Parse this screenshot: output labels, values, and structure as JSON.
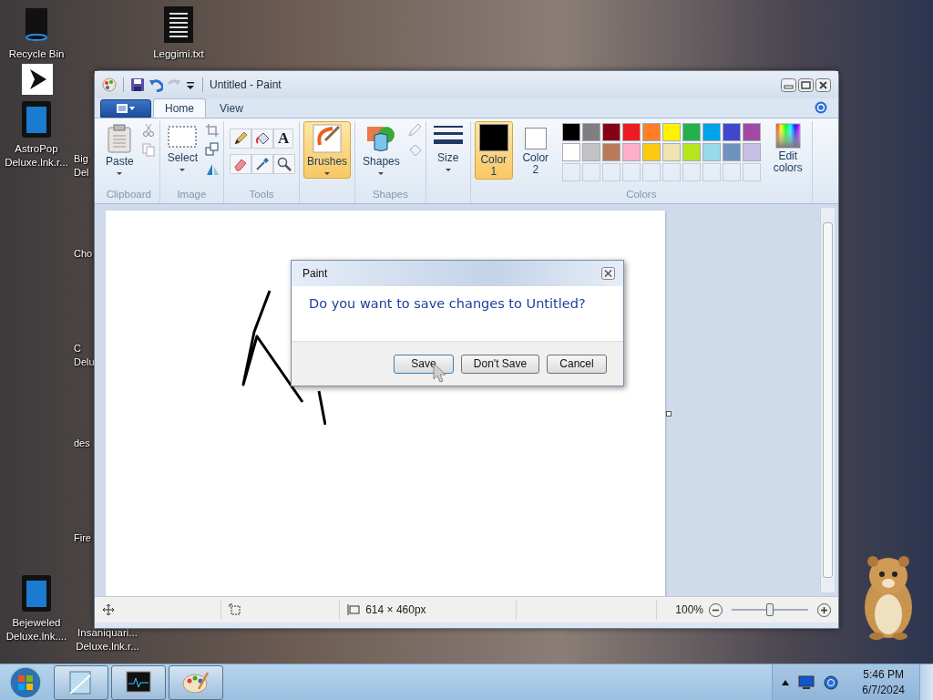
{
  "desktop_icons": [
    {
      "label": "Recycle Bin",
      "kind": "bin"
    },
    {
      "label": "Leggimi.txt",
      "kind": "document"
    },
    {
      "label": "AstroPop Deluxe.lnk.r...",
      "kind": "shortcut"
    },
    {
      "label": "Big Del",
      "kind": "covered"
    },
    {
      "label": "Cho",
      "kind": "covered"
    },
    {
      "label": "C Delu",
      "kind": "covered"
    },
    {
      "label": "des",
      "kind": "covered"
    },
    {
      "label": "Fire",
      "kind": "covered"
    },
    {
      "label": "Bejeweled Deluxe.lnk....",
      "kind": "shortcut"
    },
    {
      "label": "Insaniquari... Deluxe.lnk.r...",
      "kind": "covered"
    }
  ],
  "paint_window": {
    "title": "Untitled - Paint",
    "tabs": [
      {
        "label": "Home",
        "selected": true
      },
      {
        "label": "View",
        "selected": false
      }
    ],
    "groups": [
      {
        "kind": "clipboard",
        "label": "Clipboard",
        "button": "Paste"
      },
      {
        "kind": "image",
        "label": "Image",
        "button": "Select"
      },
      {
        "kind": "tools",
        "label": "Tools",
        "text_glyph": "A"
      },
      {
        "kind": "brushes",
        "button": "Brushes",
        "selected": true
      },
      {
        "kind": "shapes",
        "label": "Shapes",
        "button": "Shapes"
      },
      {
        "kind": "size",
        "button": "Size"
      },
      {
        "kind": "colors",
        "label": "Colors",
        "edit": "Edit colors",
        "slots": [
          {
            "label": "Color 1",
            "color": "#000000",
            "selected": true
          },
          {
            "label": "Color 2",
            "color": "#ffffff",
            "selected": false
          }
        ],
        "palette": [
          {
            "color": "#000000"
          },
          {
            "color": "#7f7f7f"
          },
          {
            "color": "#880015"
          },
          {
            "color": "#ed1c24"
          },
          {
            "color": "#ff7f27"
          },
          {
            "color": "#fff200"
          },
          {
            "color": "#22b14c"
          },
          {
            "color": "#00a2e8"
          },
          {
            "color": "#3f48cc"
          },
          {
            "color": "#a349a4"
          },
          {
            "color": "#ffffff"
          },
          {
            "color": "#c3c3c3"
          },
          {
            "color": "#b97a57"
          },
          {
            "color": "#ffaec9"
          },
          {
            "color": "#ffc90e"
          },
          {
            "color": "#efe4b0"
          },
          {
            "color": "#b5e61d"
          },
          {
            "color": "#99d9ea"
          },
          {
            "color": "#7092be"
          },
          {
            "color": "#c8bfe7"
          }
        ]
      }
    ],
    "status_bar": {
      "size": "614 × 460px",
      "zoom": "100%",
      "zoom_slider": {
        "level": 0.5
      }
    }
  },
  "dialog": {
    "title": "Paint",
    "message": "Do you want to save changes to Untitled?",
    "buttons": [
      {
        "label": "Save"
      },
      {
        "label": "Don't Save"
      },
      {
        "label": "Cancel"
      }
    ]
  },
  "taskbar": {
    "time": "5:46 PM",
    "date": "6/7/2024"
  }
}
